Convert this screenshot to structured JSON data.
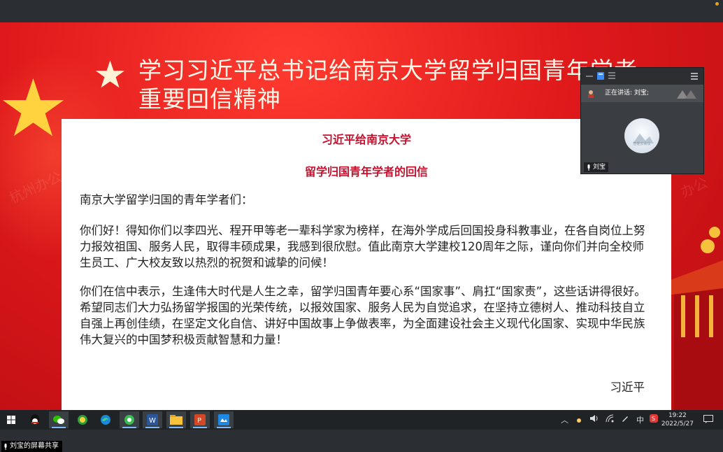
{
  "slide": {
    "title_line1": "学习习近平总书记给南京大学留学归国青年学者",
    "title_line2": "重要回信精神",
    "watermark_left": "杭州办公",
    "watermark_right": "办公"
  },
  "letter": {
    "heading1": "习近平给南京大学",
    "heading2": "留学归国青年学者的回信",
    "salutation": "南京大学留学归国的青年学者们：",
    "paragraph1": "你们好！得知你们以李四光、程开甲等老一辈科学家为榜样，在海外学成后回国投身科教事业，在各自岗位上努力报效祖国、服务人民，取得丰硕成果，我感到很欣慰。值此南京大学建校120周年之际，谨向你们并向全校师生员工、广大校友致以热烈的祝贺和诚挚的问候！",
    "paragraph2": "你们在信中表示，生逢伟大时代是人生之幸，留学归国青年要心系“国家事”、肩扛“国家责”，这些话讲得很好。希望同志们大力弘扬留学报国的光荣传统，以报效国家、服务人民为自觉追求，在坚持立德树人、推动科技自立自强上再创佳绩，在坚定文化自信、讲好中国故事上争做表率，为全面建设社会主义现代化国家、实现中华民族伟大复兴的中国梦积极贡献智慧和力量！",
    "signature": "习近平"
  },
  "video_panel": {
    "speaking_label": "正在讲话: 刘宝;",
    "participant_name": "刘宝",
    "avatar_caption": "智能云会议"
  },
  "taskbar": {
    "apps": [
      "start-icon",
      "qq-icon",
      "wechat-icon",
      "browser-360-icon",
      "edge-icon",
      "browser-icon",
      "word-icon",
      "file-explorer-icon",
      "powerpoint-icon",
      "meeting-app-icon"
    ],
    "ime_label": "中",
    "time": "19:22",
    "date": "2022/5/27"
  },
  "share_status": {
    "label": "刘宝的屏幕共享"
  },
  "colors": {
    "slide_red": "#e0191b",
    "heading_red": "#c8102e",
    "star_gold": "#ffd23f",
    "taskbar_bg": "#1f2326"
  }
}
